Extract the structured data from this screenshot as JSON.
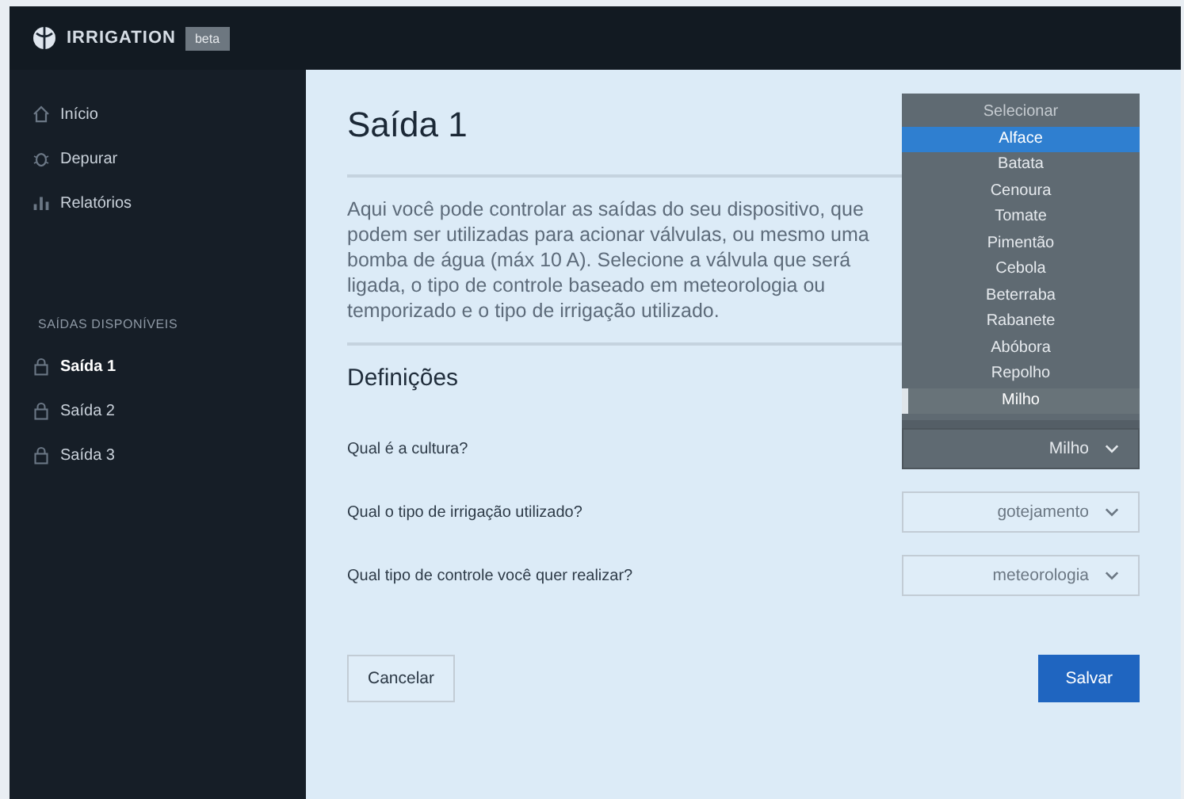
{
  "brand": {
    "name": "IRRIGATION",
    "badge": "beta"
  },
  "sidebar": {
    "items": [
      {
        "label": "Início",
        "selected": false
      },
      {
        "label": "Depurar",
        "selected": false
      },
      {
        "label": "Relatórios",
        "selected": false
      }
    ],
    "section_title": "SAÍDAS DISPONÍVEIS",
    "outputs": [
      {
        "label": "Saída 1",
        "selected": true
      },
      {
        "label": "Saída 2",
        "selected": false
      },
      {
        "label": "Saída 3",
        "selected": false
      }
    ]
  },
  "page": {
    "title": "Saída 1",
    "description": "Aqui você pode controlar as saídas do seu dispositivo, que podem ser utilizadas para acionar válvulas, ou mesmo uma bomba de água (máx 10 A). Selecione a válvula que será ligada, o tipo de controle baseado em meteorologia ou temporizado e o tipo de irrigação utilizado.",
    "settings_title": "Definições",
    "fields": [
      {
        "label": "Qual é a cultura?",
        "value": "Milho",
        "expanded": true,
        "options": [
          {
            "label": "Selecionar",
            "disabled": true,
            "selected": false
          },
          {
            "label": "Alface",
            "disabled": false,
            "selected": false,
            "highlighted": true
          },
          {
            "label": "Batata",
            "disabled": false,
            "selected": false
          },
          {
            "label": "Cenoura",
            "disabled": false,
            "selected": false
          },
          {
            "label": "Tomate",
            "disabled": false,
            "selected": false
          },
          {
            "label": "Pimentão",
            "disabled": false,
            "selected": false
          },
          {
            "label": "Cebola",
            "disabled": false,
            "selected": false
          },
          {
            "label": "Beterraba",
            "disabled": false,
            "selected": false
          },
          {
            "label": "Rabanete",
            "disabled": false,
            "selected": false
          },
          {
            "label": "Abóbora",
            "disabled": false,
            "selected": false
          },
          {
            "label": "Repolho",
            "disabled": false,
            "selected": false
          },
          {
            "label": "Milho",
            "disabled": false,
            "selected": true
          }
        ]
      },
      {
        "label": "Qual o tipo de irrigação utilizado?",
        "value": "gotejamento",
        "expanded": false
      },
      {
        "label": "Qual tipo de controle você quer realizar?",
        "value": "meteorologia",
        "expanded": false
      }
    ],
    "buttons": [
      {
        "label": "Cancelar",
        "kind": "secondary"
      },
      {
        "label": "Salvar",
        "kind": "primary"
      }
    ]
  }
}
